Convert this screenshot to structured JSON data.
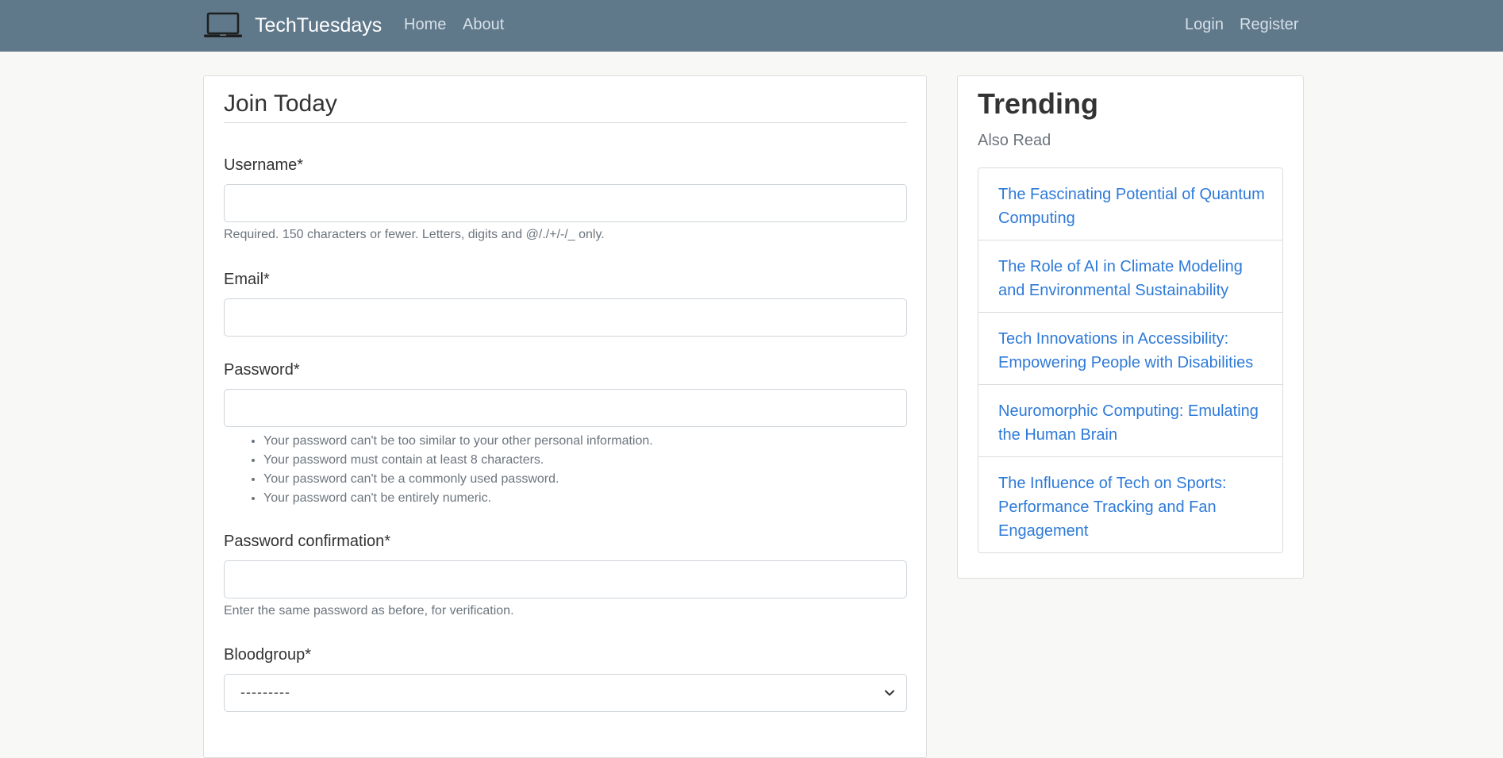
{
  "navbar": {
    "brand_icon": "laptop-icon",
    "brand": "TechTuesdays",
    "home": "Home",
    "about": "About",
    "login": "Login",
    "register": "Register",
    "background": "#5f788a"
  },
  "form": {
    "legend": "Join Today",
    "username_label": "Username*",
    "username_help": "Required. 150 characters or fewer. Letters, digits and @/./+/-/_ only.",
    "email_label": "Email*",
    "password_label": "Password*",
    "password_rules": [
      "Your password can't be too similar to your other personal information.",
      "Your password must contain at least 8 characters.",
      "Your password can't be a commonly used password.",
      "Your password can't be entirely numeric."
    ],
    "password2_label": "Password confirmation*",
    "password2_help": "Enter the same password as before, for verification.",
    "bloodgroup_label": "Bloodgroup*",
    "bloodgroup_value": "---------"
  },
  "sidebar": {
    "title": "Trending",
    "subtitle": "Also Read",
    "link_color": "#2e7ad8",
    "items": [
      "The Fascinating Potential of Quantum Computing",
      "The Role of AI in Climate Modeling and Environmental Sustainability",
      "Tech Innovations in Accessibility: Empowering People with Disabilities",
      "Neuromorphic Computing: Emulating the Human Brain",
      "The Influence of Tech on Sports: Performance Tracking and Fan Engagement"
    ]
  }
}
